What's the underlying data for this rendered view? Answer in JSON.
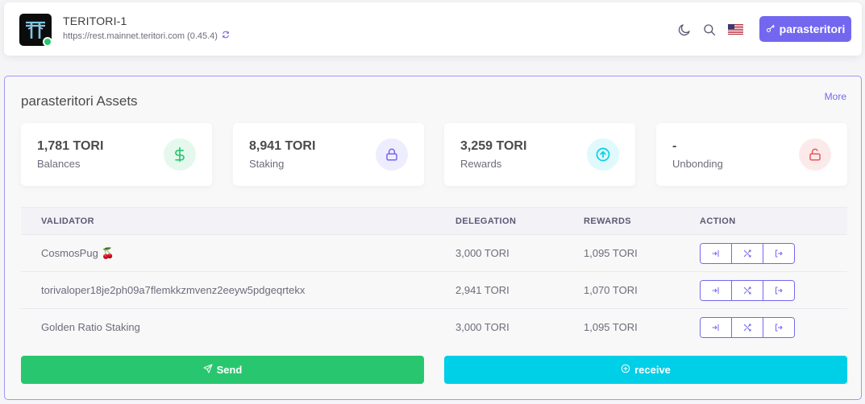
{
  "header": {
    "chain_name": "TERITORI-1",
    "rest_url": "https://rest.mainnet.teritori.com (0.45.4)",
    "account_label": "parasteritori",
    "icons": [
      "moon-icon",
      "search-icon",
      "us-flag-icon",
      "key-icon",
      "sync-icon"
    ]
  },
  "assets": {
    "title": "parasteritori Assets",
    "more_label": "More",
    "stats": [
      {
        "value": "1,781 TORI",
        "label": "Balances",
        "icon": "dollar-icon",
        "color": "#28c76f",
        "bg": "#e5f8ed"
      },
      {
        "value": "8,941 TORI",
        "label": "Staking",
        "icon": "lock-icon",
        "color": "#7367f0",
        "bg": "#eeedfd"
      },
      {
        "value": "3,259 TORI",
        "label": "Rewards",
        "icon": "arrow-up-circle-icon",
        "color": "#00cfe8",
        "bg": "#e0f9fc"
      },
      {
        "value": "-",
        "label": "Unbonding",
        "icon": "unlock-icon",
        "color": "#ea5455",
        "bg": "#fceaea"
      }
    ]
  },
  "table": {
    "headers": {
      "validator": "VALIDATOR",
      "delegation": "DELEGATION",
      "rewards": "REWARDS",
      "action": "ACTION"
    },
    "rows": [
      {
        "validator": "CosmosPug",
        "emoji": "🍒",
        "delegation": "3,000 TORI",
        "rewards": "1,095 TORI"
      },
      {
        "validator": "torivaloper18je2ph09a7flemkkzmvenz2eeyw5pdgeqrtekx",
        "emoji": "",
        "delegation": "2,941 TORI",
        "rewards": "1,070 TORI"
      },
      {
        "validator": "Golden Ratio Staking",
        "emoji": "",
        "delegation": "3,000 TORI",
        "rewards": "1,095 TORI"
      }
    ],
    "action_icons": [
      "delegate-icon",
      "redelegate-icon",
      "unbond-icon"
    ]
  },
  "footer": {
    "send_label": "Send",
    "receive_label": "receive"
  },
  "colors": {
    "primary": "#7367f0",
    "success": "#28c76f",
    "info": "#00cfe8",
    "danger": "#ea5455"
  }
}
